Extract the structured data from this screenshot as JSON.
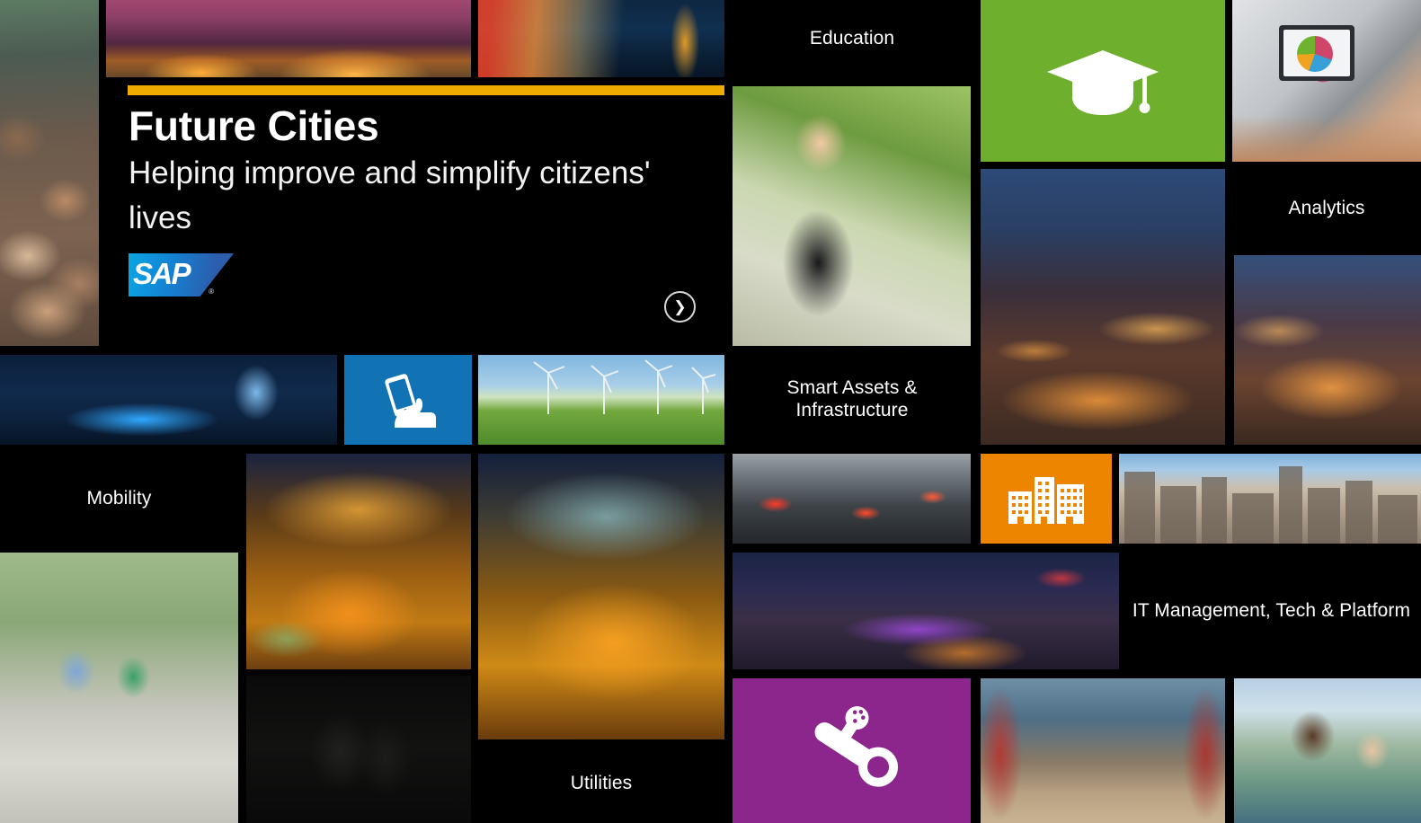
{
  "page": {
    "background_color": "#000000",
    "text_color": "#ffffff"
  },
  "hero": {
    "accent_bar_color": "#f0ab00",
    "title": "Future Cities",
    "subtitle": "Helping improve and simplify citizens' lives",
    "logo_text": "SAP",
    "logo_registered_mark": "®",
    "next_icon": "chevron-right-icon",
    "next_glyph": "❯"
  },
  "labels": {
    "education": "Education",
    "analytics": "Analytics",
    "smart_assets": "Smart Assets & Infrastructure",
    "mobility": "Mobility",
    "utilities": "Utilities",
    "it_management": "IT Management, Tech & Platform"
  },
  "icon_tiles": [
    {
      "name": "graduation-cap-icon",
      "label": "Education",
      "color": "#6faf2e"
    },
    {
      "name": "hand-smartphone-icon",
      "label": "Mobility",
      "color": "#1273b4"
    },
    {
      "name": "city-buildings-icon",
      "label": "Smart Assets & Infrastructure",
      "color": "#ee8500"
    },
    {
      "name": "water-valve-icon",
      "label": "Utilities",
      "color": "#8c268c"
    }
  ],
  "photo_tiles": [
    {
      "name": "crowd-street-photo",
      "alt": "Crowd of people on a street"
    },
    {
      "name": "city-skyline-dusk-photo",
      "alt": "City skyline at dusk with purple sky"
    },
    {
      "name": "london-bus-bigben-photo",
      "alt": "London bus light trails and Big Ben at night"
    },
    {
      "name": "woman-tablet-park-photo",
      "alt": "Businesswoman with a tablet in a park"
    },
    {
      "name": "city-night-aerial-photo",
      "alt": "Aerial view of a city at night"
    },
    {
      "name": "city-night-aerial-2-photo",
      "alt": "Aerial view of a city at night"
    },
    {
      "name": "tablet-pie-chart-photo",
      "alt": "Hand holding a tablet showing a pie chart"
    },
    {
      "name": "blue-bridge-night-photo",
      "alt": "Illuminated blue arch bridge at night"
    },
    {
      "name": "wind-turbines-photo",
      "alt": "Wind turbines in a green field"
    },
    {
      "name": "traffic-cars-photo",
      "alt": "Cars in traffic"
    },
    {
      "name": "boston-skyline-photo",
      "alt": "Boston skyline in daylight"
    },
    {
      "name": "river-bridge-night-photo",
      "alt": "Illuminated bridge over a river at night"
    },
    {
      "name": "cyclists-walking-photo",
      "alt": "Two people walking with bicycles"
    },
    {
      "name": "highway-interchange-photo",
      "alt": "Highway interchange light trails at night"
    },
    {
      "name": "highway-interchange-2-photo",
      "alt": "Highway interchange light trails at night"
    },
    {
      "name": "dark-silhouette-photo",
      "alt": "Dark tile with faint silhouettes"
    },
    {
      "name": "red-steel-bridge-photo",
      "alt": "Walkway across a red steel bridge"
    },
    {
      "name": "smiling-people-photo",
      "alt": "Group of smiling young people"
    }
  ]
}
